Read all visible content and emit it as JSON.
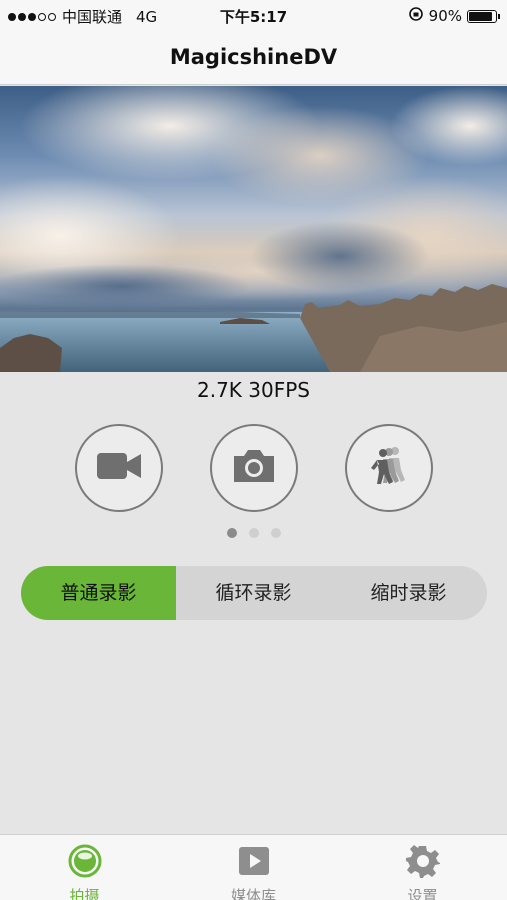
{
  "status_bar": {
    "carrier": "中国联通",
    "network": "4G",
    "time": "下午5:17",
    "battery": "90%",
    "battery_level": 0.9
  },
  "nav": {
    "title": "MagicshineDV"
  },
  "preview": {
    "resolution": "2.7K 30FPS"
  },
  "modes": [
    {
      "name": "video-camera-icon"
    },
    {
      "name": "photo-camera-icon"
    },
    {
      "name": "burst-runner-icon"
    }
  ],
  "pager": {
    "count": 3,
    "active": 0
  },
  "segments": {
    "normal": "普通录影",
    "loop": "循环录影",
    "timelapse": "缩时录影",
    "active": "normal"
  },
  "tabs": {
    "shoot": "拍摄",
    "media": "媒体库",
    "settings": "设置",
    "active": "shoot"
  },
  "colors": {
    "accent": "#6ab638",
    "inactive": "#8e8e8e"
  }
}
